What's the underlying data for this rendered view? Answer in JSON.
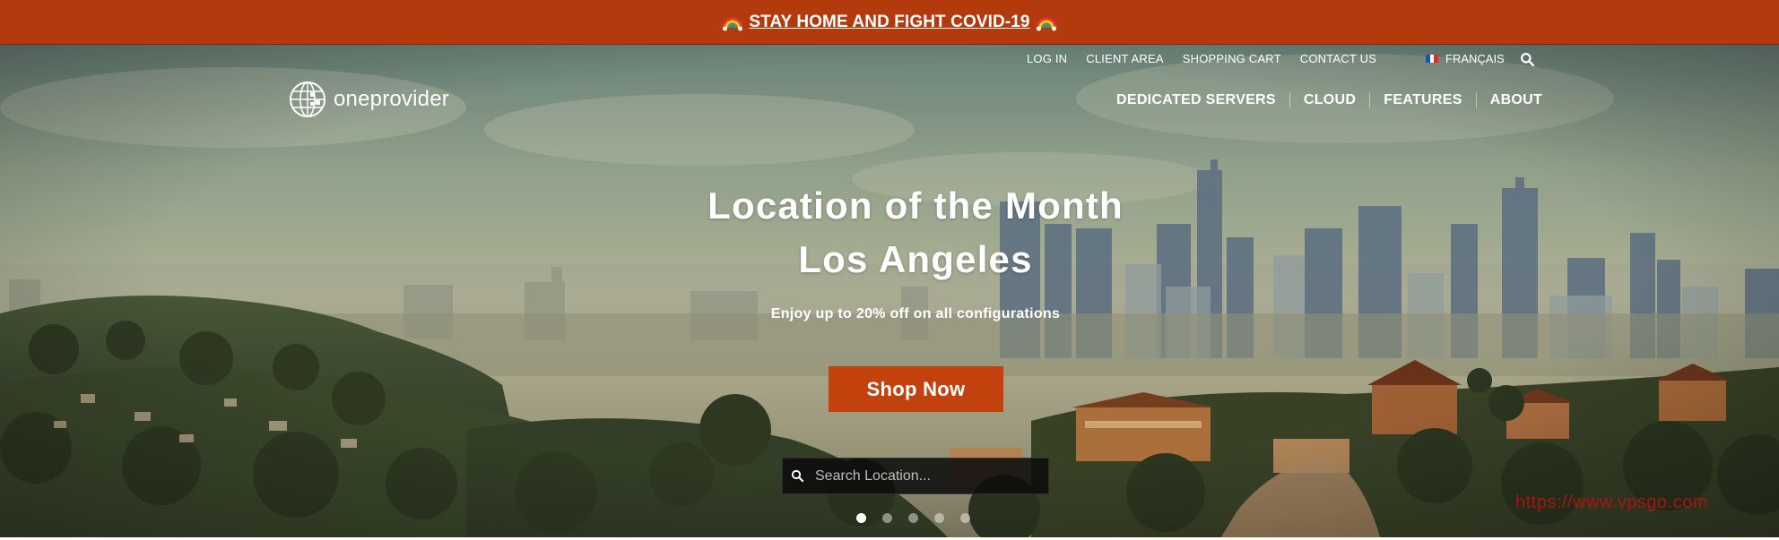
{
  "banner": {
    "text": "STAY HOME AND FIGHT COVID-19",
    "background": "#b23a0c"
  },
  "util_nav": {
    "items": [
      "LOG IN",
      "CLIENT AREA",
      "SHOPPING CART",
      "CONTACT US"
    ],
    "language": "FRANÇAIS",
    "search_icon": "search-icon"
  },
  "logo": {
    "text": "oneprovider"
  },
  "main_nav": {
    "items": [
      "DEDICATED SERVERS",
      "CLOUD",
      "FEATURES",
      "ABOUT"
    ]
  },
  "hero": {
    "title_line1": "Location of the Month",
    "title_line2": "Los Angeles",
    "subtitle": "Enjoy up to 20% off on all configurations",
    "cta_label": "Shop Now",
    "cta_color": "#c2410d",
    "search_placeholder": "Search Location...",
    "slides_total": 5,
    "active_slide": 1
  },
  "watermark": "https://www.vpsgo.com"
}
